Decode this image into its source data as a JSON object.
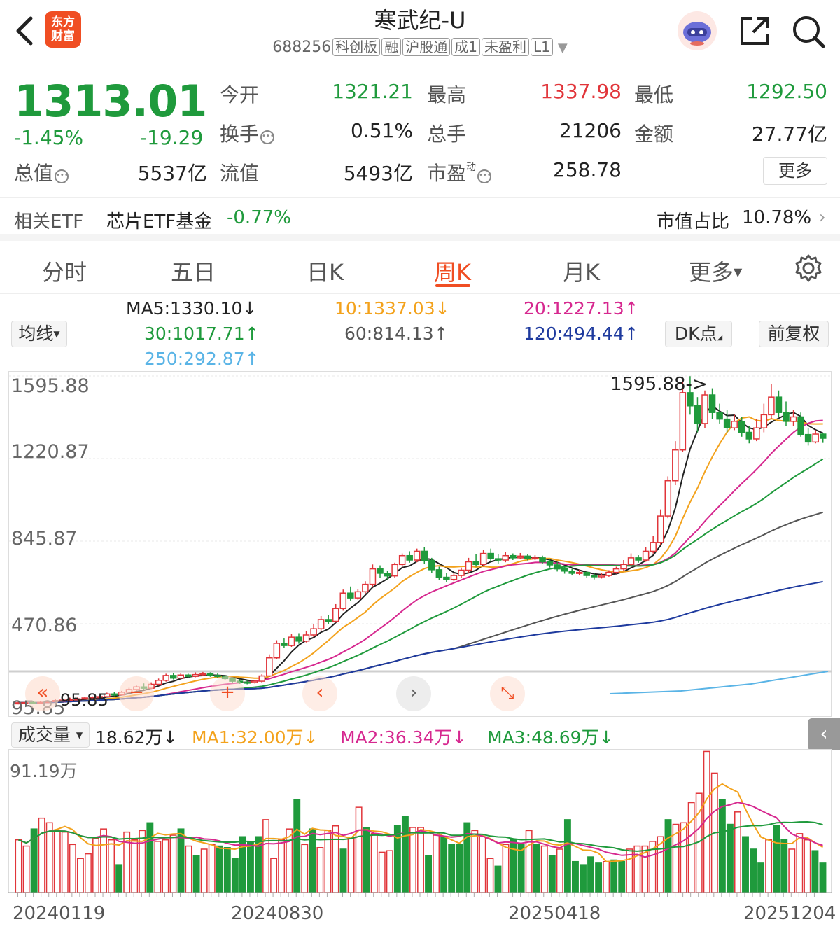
{
  "header": {
    "title": "寒武纪-U",
    "code": "688256",
    "tags": [
      "科创板",
      "融",
      "沪股通",
      "成1",
      "未盈利",
      "L1"
    ],
    "logo_text": "东方财富"
  },
  "quote": {
    "price": "1313.01",
    "change_pct": "-1.45%",
    "change": "-19.29",
    "open_label": "今开",
    "open": "1321.21",
    "high_label": "最高",
    "high": "1337.98",
    "low_label": "最低",
    "low": "1292.50",
    "turnover_label": "换手",
    "turnover": "0.51%",
    "volume_label": "总手",
    "volume": "21206",
    "amount_label": "金额",
    "amount": "27.77亿",
    "mktcap_label": "总值",
    "mktcap": "5537亿",
    "float_label": "流值",
    "float": "5493亿",
    "pe_label": "市盈",
    "pe_sup": "动",
    "pe": "258.78",
    "more": "更多"
  },
  "etf": {
    "label": "相关ETF",
    "name": "芯片ETF基金",
    "change": "-0.77%",
    "ratio_label": "市值占比",
    "ratio": "10.78%"
  },
  "tabs": [
    "分时",
    "五日",
    "日K",
    "周K",
    "月K",
    "更多"
  ],
  "active_tab": "周K",
  "ma": {
    "selector": "均线",
    "ma5": "MA5:1330.10↓",
    "ma10": "10:1337.03↓",
    "ma20": "20:1227.13↑",
    "ma30": "30:1017.71↑",
    "ma60": "60:814.13↑",
    "ma120": "120:494.44↑",
    "ma250": "250:292.87↑",
    "dk_button": "DK点",
    "adjust_button": "前复权"
  },
  "colors": {
    "up": "#e1353a",
    "down": "#1f9a3c",
    "brand": "#f04e23",
    "ma5": "#222222",
    "ma10": "#f3a21c",
    "ma20": "#d6288f",
    "ma30": "#1f9a3c",
    "ma60": "#555555",
    "ma120": "#1e3a9e",
    "ma250": "#5ab4e6"
  },
  "volume": {
    "selector": "成交量",
    "current": "18.62万↓",
    "ma1": "MA1:32.00万↓",
    "ma2": "MA2:36.34万↓",
    "ma3": "MA3:48.69万↓",
    "max_label": "91.19万"
  },
  "chart_data": {
    "type": "candlestick",
    "y_ticks": [
      "1595.88",
      "1220.87",
      "845.87",
      "470.86",
      "95.85"
    ],
    "high_marker": "1595.88->",
    "low_marker": "95.85",
    "x_labels": [
      "20240119",
      "20240830",
      "20250418",
      "20251204"
    ],
    "ylim": [
      95.85,
      1595.88
    ],
    "candles": [
      [
        110,
        112,
        105,
        118
      ],
      [
        112,
        113,
        106,
        120
      ],
      [
        113,
        111,
        107,
        119
      ],
      [
        111,
        114,
        108,
        121
      ],
      [
        114,
        118,
        112,
        124
      ],
      [
        118,
        122,
        115,
        128
      ],
      [
        122,
        124,
        118,
        130
      ],
      [
        124,
        128,
        121,
        135
      ],
      [
        128,
        130,
        123,
        136
      ],
      [
        130,
        134,
        126,
        140
      ],
      [
        134,
        136,
        128,
        142
      ],
      [
        136,
        140,
        131,
        146
      ],
      [
        140,
        152,
        136,
        158
      ],
      [
        152,
        148,
        142,
        160
      ],
      [
        148,
        160,
        144,
        166
      ],
      [
        160,
        172,
        155,
        180
      ],
      [
        172,
        184,
        166,
        190
      ],
      [
        184,
        178,
        172,
        200
      ],
      [
        178,
        196,
        174,
        205
      ],
      [
        196,
        214,
        190,
        222
      ],
      [
        214,
        236,
        208,
        244
      ],
      [
        236,
        224,
        218,
        248
      ],
      [
        224,
        238,
        220,
        246
      ],
      [
        238,
        232,
        226,
        244
      ],
      [
        232,
        240,
        228,
        250
      ],
      [
        240,
        244,
        234,
        252
      ],
      [
        244,
        236,
        230,
        250
      ],
      [
        236,
        232,
        224,
        246
      ],
      [
        232,
        222,
        216,
        238
      ],
      [
        222,
        210,
        204,
        228
      ],
      [
        210,
        206,
        198,
        218
      ],
      [
        206,
        204,
        196,
        212
      ],
      [
        204,
        210,
        200,
        216
      ],
      [
        210,
        234,
        204,
        242
      ],
      [
        234,
        316,
        230,
        332
      ],
      [
        316,
        382,
        310,
        396
      ],
      [
        382,
        372,
        362,
        404
      ],
      [
        372,
        410,
        366,
        426
      ],
      [
        410,
        392,
        380,
        428
      ],
      [
        392,
        420,
        386,
        438
      ],
      [
        420,
        448,
        410,
        470
      ],
      [
        448,
        490,
        440,
        506
      ],
      [
        490,
        482,
        470,
        512
      ],
      [
        482,
        540,
        476,
        560
      ],
      [
        540,
        610,
        530,
        626
      ],
      [
        610,
        588,
        576,
        640
      ],
      [
        588,
        616,
        580,
        628
      ],
      [
        616,
        650,
        606,
        664
      ],
      [
        650,
        720,
        640,
        740
      ],
      [
        720,
        700,
        680,
        736
      ],
      [
        700,
        688,
        672,
        712
      ],
      [
        688,
        740,
        680,
        748
      ],
      [
        740,
        780,
        730,
        790
      ],
      [
        780,
        760,
        748,
        800
      ],
      [
        760,
        800,
        750,
        812
      ],
      [
        800,
        758,
        742,
        820
      ],
      [
        758,
        716,
        700,
        770
      ],
      [
        716,
        682,
        670,
        730
      ],
      [
        682,
        672,
        660,
        700
      ],
      [
        672,
        690,
        664,
        702
      ],
      [
        690,
        714,
        680,
        726
      ],
      [
        714,
        752,
        700,
        770
      ],
      [
        752,
        740,
        730,
        788
      ],
      [
        740,
        790,
        730,
        806
      ],
      [
        790,
        766,
        752,
        812
      ],
      [
        766,
        760,
        744,
        788
      ],
      [
        760,
        780,
        750,
        796
      ],
      [
        780,
        770,
        760,
        790
      ],
      [
        770,
        778,
        764,
        792
      ],
      [
        778,
        768,
        758,
        788
      ],
      [
        768,
        770,
        760,
        782
      ],
      [
        770,
        752,
        742,
        780
      ],
      [
        752,
        738,
        726,
        762
      ],
      [
        738,
        720,
        708,
        750
      ],
      [
        720,
        710,
        698,
        730
      ],
      [
        710,
        700,
        690,
        720
      ],
      [
        700,
        704,
        690,
        716
      ],
      [
        704,
        690,
        680,
        712
      ],
      [
        690,
        684,
        672,
        700
      ],
      [
        684,
        690,
        676,
        700
      ],
      [
        690,
        704,
        684,
        714
      ],
      [
        704,
        720,
        698,
        730
      ],
      [
        720,
        740,
        712,
        760
      ],
      [
        740,
        770,
        730,
        790
      ],
      [
        770,
        760,
        748,
        782
      ],
      [
        760,
        800,
        752,
        820
      ],
      [
        800,
        840,
        790,
        870
      ],
      [
        840,
        960,
        830,
        990
      ],
      [
        960,
        1120,
        950,
        1140
      ],
      [
        1120,
        1260,
        1100,
        1300
      ],
      [
        1260,
        1520,
        1250,
        1580
      ],
      [
        1520,
        1460,
        1420,
        1595
      ],
      [
        1460,
        1380,
        1340,
        1500
      ],
      [
        1380,
        1510,
        1360,
        1530
      ],
      [
        1510,
        1430,
        1400,
        1540
      ],
      [
        1430,
        1400,
        1380,
        1470
      ],
      [
        1400,
        1360,
        1340,
        1440
      ],
      [
        1360,
        1390,
        1350,
        1420
      ],
      [
        1390,
        1340,
        1320,
        1410
      ],
      [
        1340,
        1310,
        1290,
        1370
      ],
      [
        1310,
        1360,
        1300,
        1400
      ],
      [
        1360,
        1420,
        1340,
        1470
      ],
      [
        1420,
        1500,
        1400,
        1560
      ],
      [
        1500,
        1430,
        1410,
        1530
      ],
      [
        1430,
        1390,
        1370,
        1480
      ],
      [
        1390,
        1410,
        1370,
        1440
      ],
      [
        1410,
        1330,
        1320,
        1430
      ],
      [
        1330,
        1296,
        1280,
        1360
      ],
      [
        1296,
        1332,
        1290,
        1350
      ],
      [
        1332,
        1313,
        1292,
        1338
      ]
    ],
    "volume_values": [
      34,
      30,
      41,
      48,
      45,
      40,
      39,
      31,
      22,
      25,
      35,
      41,
      34,
      18,
      39,
      34,
      40,
      45,
      33,
      34,
      37,
      41,
      30,
      24,
      28,
      31,
      30,
      29,
      22,
      36,
      33,
      36,
      47,
      22,
      34,
      41,
      60,
      31,
      41,
      29,
      40,
      43,
      28,
      35,
      55,
      42,
      38,
      26,
      27,
      43,
      49,
      42,
      42,
      24,
      37,
      36,
      31,
      31,
      45,
      40,
      36,
      22,
      17,
      31,
      34,
      31,
      40,
      31,
      30,
      24,
      28,
      47,
      20,
      18,
      23,
      19,
      20,
      21,
      20,
      28,
      30,
      30,
      33,
      36,
      47,
      44,
      45,
      58,
      64,
      91,
      77,
      60,
      44,
      52,
      36,
      28,
      19,
      34,
      43,
      34,
      28,
      38,
      34,
      27,
      19
    ]
  }
}
